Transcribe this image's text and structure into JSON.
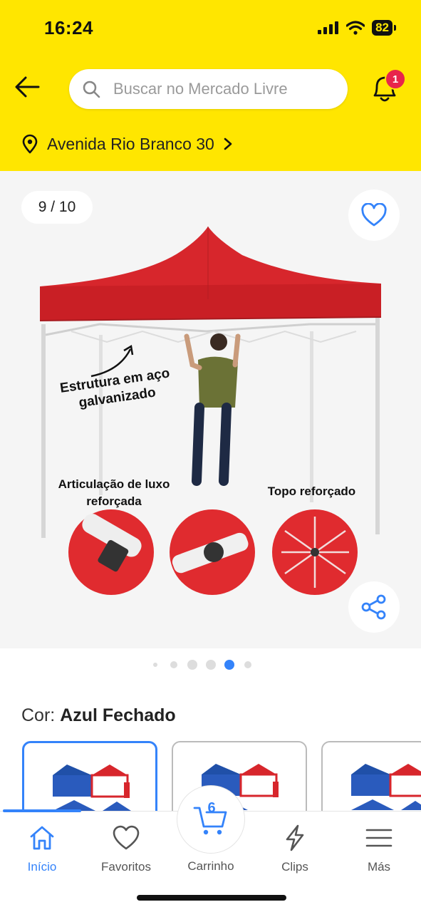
{
  "status_bar": {
    "time": "16:24",
    "battery": "82"
  },
  "header": {
    "search_placeholder": "Buscar no Mercado Livre",
    "notification_count": "1",
    "address": "Avenida Rio Branco 30"
  },
  "gallery": {
    "counter": "9 / 10",
    "captions": {
      "structure": "Estrutura em aço galvanizado",
      "joint": "Articulação de luxo reforçada",
      "top": "Topo reforçado"
    },
    "dot_count": 6,
    "active_dot": 4
  },
  "product": {
    "color_label": "Cor:",
    "color_value": "Azul Fechado"
  },
  "bottom_nav": {
    "items": [
      {
        "label": "Início",
        "icon": "home-icon",
        "active": true
      },
      {
        "label": "Favoritos",
        "icon": "heart-icon",
        "active": false
      },
      {
        "label": "Carrinho",
        "icon": "cart-icon",
        "active": false
      },
      {
        "label": "Clips",
        "icon": "lightning-icon",
        "active": false
      },
      {
        "label": "Más",
        "icon": "menu-icon",
        "active": false
      }
    ],
    "cart_count": "6"
  },
  "colors": {
    "brand_yellow": "#ffe600",
    "accent_blue": "#3483fa",
    "badge_red": "#e8254b",
    "tent_red": "#d7262c"
  }
}
